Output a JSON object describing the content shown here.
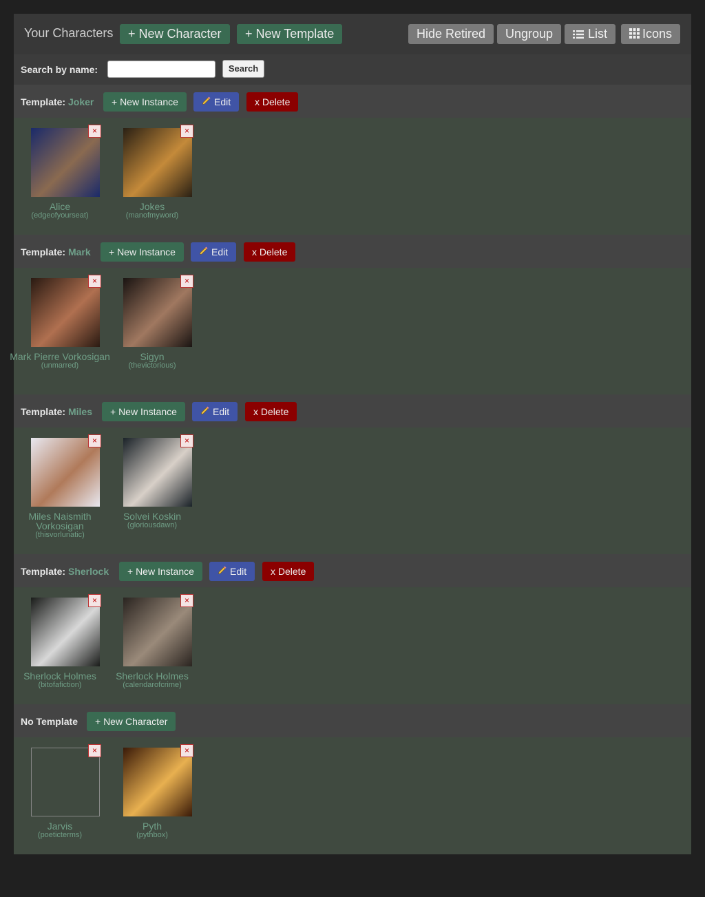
{
  "header": {
    "title": "Your Characters",
    "new_character": "+ New Character",
    "new_template": "+ New Template",
    "hide_retired": "Hide Retired",
    "ungroup": "Ungroup",
    "list": "List",
    "icons": "Icons"
  },
  "search": {
    "label": "Search by name:",
    "value": "",
    "button": "Search"
  },
  "labels": {
    "template_prefix": "Template:",
    "new_instance": "+ New Instance",
    "edit": "Edit",
    "delete": "x Delete",
    "close": "×",
    "no_template": "No Template",
    "new_character": "+ New Character"
  },
  "groups": [
    {
      "name": "Joker",
      "characters": [
        {
          "name": "Alice",
          "handle": "(edgeofyourseat)",
          "colors": [
            "#1a2a6a",
            "#8a6a50"
          ]
        },
        {
          "name": "Jokes",
          "handle": "(manofmyword)",
          "colors": [
            "#2a2014",
            "#c48a3a"
          ]
        }
      ]
    },
    {
      "name": "Mark",
      "characters": [
        {
          "name": "Mark Pierre Vorkosigan",
          "handle": "(unmarred)",
          "colors": [
            "#2a1a12",
            "#b07050"
          ]
        },
        {
          "name": "Sigyn",
          "handle": "(thevictorious)",
          "colors": [
            "#1a1412",
            "#a07860"
          ]
        }
      ]
    },
    {
      "name": "Miles",
      "characters": [
        {
          "name": "Miles Naismith Vorkosigan",
          "handle": "(thisvorlunatic)",
          "colors": [
            "#e8e8f0",
            "#b07a5a"
          ]
        },
        {
          "name": "Solvei Koskin",
          "handle": "(gloriousdawn)",
          "colors": [
            "#1a2228",
            "#d8d0c8"
          ]
        }
      ]
    },
    {
      "name": "Sherlock",
      "characters": [
        {
          "name": "Sherlock Holmes",
          "handle": "(bitofafiction)",
          "colors": [
            "#1a1c1a",
            "#d8d8d8"
          ]
        },
        {
          "name": "Sherlock Holmes",
          "handle": "(calendarofcrime)",
          "colors": [
            "#2a2420",
            "#9a8a7a"
          ]
        }
      ]
    }
  ],
  "no_template": {
    "characters": [
      {
        "name": "Jarvis",
        "handle": "(poeticterms)",
        "colors": []
      },
      {
        "name": "Pyth",
        "handle": "(pythbox)",
        "colors": [
          "#3a1a08",
          "#e8b050"
        ]
      }
    ]
  }
}
